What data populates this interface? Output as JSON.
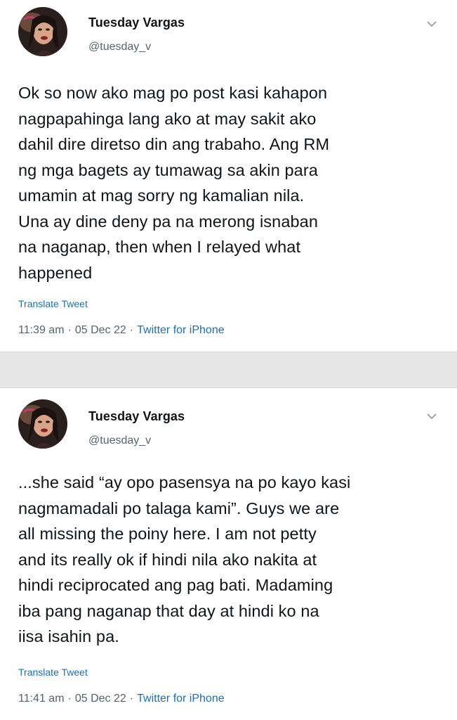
{
  "tweets": [
    {
      "author_name": "Tuesday Vargas",
      "author_handle": "@tuesday_v",
      "text": "Ok so now ako mag po post kasi kahapon\nnagpapahinga lang ako at may sakit ako\ndahil dire diretso din ang trabaho. Ang RM\nng mga bagets ay tumawag sa akin para\numamin at mag sorry ng kamalian nila.\nUna ay dine deny pa na merong isnaban\nna naganap, then when I relayed what\nhappened",
      "translate_label": "Translate Tweet",
      "time": "11:39 am",
      "date": "05 Dec 22",
      "source": "Twitter for iPhone",
      "separator": "·"
    },
    {
      "author_name": "Tuesday Vargas",
      "author_handle": "@tuesday_v",
      "text": "...she said “ay opo pasensya na po kayo kasi\nnagmamadali po talaga kami”. Guys we are\nall missing the poiny here. I am not petty\nand its really ok if hindi nila ako nakita at\nhindi reciprocated ang pag bati. Madaming\niba pang naganap that day at hindi ko na\niisa isahin pa.",
      "translate_label": "Translate Tweet",
      "time": "11:41 am",
      "date": "05 Dec 22",
      "source": "Twitter for iPhone",
      "separator": "·"
    }
  ],
  "icons": {
    "more": "chevron-down-icon"
  },
  "colors": {
    "text": "#0f1419",
    "secondary": "#536471",
    "link": "#1d6fb0",
    "divider": "#e6e6e6"
  }
}
